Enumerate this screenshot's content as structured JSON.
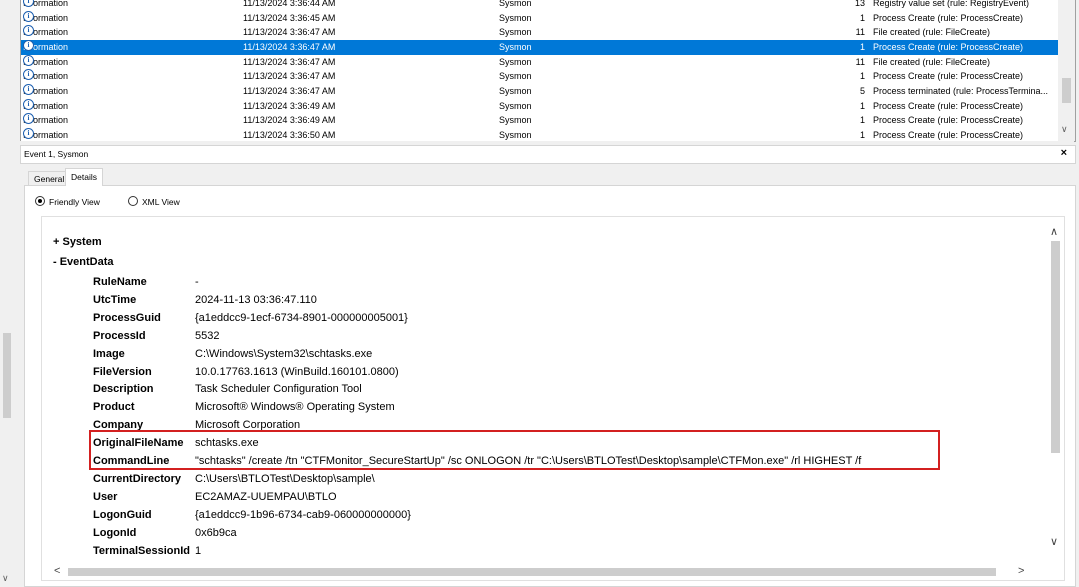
{
  "grid": {
    "rows": [
      {
        "level": "Information",
        "date": "11/13/2024 3:36:44 AM",
        "source": "Sysmon",
        "event_id": "13",
        "task": "Registry value set (rule: RegistryEvent)"
      },
      {
        "level": "Information",
        "date": "11/13/2024 3:36:45 AM",
        "source": "Sysmon",
        "event_id": "1",
        "task": "Process Create (rule: ProcessCreate)"
      },
      {
        "level": "Information",
        "date": "11/13/2024 3:36:47 AM",
        "source": "Sysmon",
        "event_id": "11",
        "task": "File created (rule: FileCreate)"
      },
      {
        "level": "Information",
        "date": "11/13/2024 3:36:47 AM",
        "source": "Sysmon",
        "event_id": "1",
        "task": "Process Create (rule: ProcessCreate)",
        "selected": true
      },
      {
        "level": "Information",
        "date": "11/13/2024 3:36:47 AM",
        "source": "Sysmon",
        "event_id": "11",
        "task": "File created (rule: FileCreate)"
      },
      {
        "level": "Information",
        "date": "11/13/2024 3:36:47 AM",
        "source": "Sysmon",
        "event_id": "1",
        "task": "Process Create (rule: ProcessCreate)"
      },
      {
        "level": "Information",
        "date": "11/13/2024 3:36:47 AM",
        "source": "Sysmon",
        "event_id": "5",
        "task": "Process terminated (rule: ProcessTermina..."
      },
      {
        "level": "Information",
        "date": "11/13/2024 3:36:49 AM",
        "source": "Sysmon",
        "event_id": "1",
        "task": "Process Create (rule: ProcessCreate)"
      },
      {
        "level": "Information",
        "date": "11/13/2024 3:36:49 AM",
        "source": "Sysmon",
        "event_id": "1",
        "task": "Process Create (rule: ProcessCreate)"
      },
      {
        "level": "Information",
        "date": "11/13/2024 3:36:50 AM",
        "source": "Sysmon",
        "event_id": "1",
        "task": "Process Create (rule: ProcessCreate)"
      }
    ]
  },
  "event_header": {
    "title": "Event 1, Sysmon",
    "close": "×"
  },
  "tabs": {
    "general": "General",
    "details": "Details"
  },
  "view_mode": {
    "friendly": "Friendly View",
    "xml": "XML View"
  },
  "tree": {
    "system": "+ System",
    "eventdata": "- EventData"
  },
  "event_data": [
    {
      "key": "RuleName",
      "value": "-"
    },
    {
      "key": "UtcTime",
      "value": "2024-11-13 03:36:47.110"
    },
    {
      "key": "ProcessGuid",
      "value": "{a1eddcc9-1ecf-6734-8901-000000005001}"
    },
    {
      "key": "ProcessId",
      "value": "5532"
    },
    {
      "key": "Image",
      "value": "C:\\Windows\\System32\\schtasks.exe"
    },
    {
      "key": "FileVersion",
      "value": "10.0.17763.1613 (WinBuild.160101.0800)"
    },
    {
      "key": "Description",
      "value": "Task Scheduler Configuration Tool"
    },
    {
      "key": "Product",
      "value": "Microsoft® Windows® Operating System"
    },
    {
      "key": "Company",
      "value": "Microsoft Corporation"
    },
    {
      "key": "OriginalFileName",
      "value": "schtasks.exe"
    },
    {
      "key": "CommandLine",
      "value": "\"schtasks\" /create /tn \"CTFMonitor_SecureStartUp\" /sc ONLOGON /tr \"C:\\Users\\BTLOTest\\Desktop\\sample\\CTFMon.exe\" /rl HIGHEST /f"
    },
    {
      "key": "CurrentDirectory",
      "value": "C:\\Users\\BTLOTest\\Desktop\\sample\\"
    },
    {
      "key": "User",
      "value": "EC2AMAZ-UUEMPAU\\BTLO"
    },
    {
      "key": "LogonGuid",
      "value": "{a1eddcc9-1b96-6734-cab9-060000000000}"
    },
    {
      "key": "LogonId",
      "value": "0x6b9ca"
    },
    {
      "key": "TerminalSessionId",
      "value": "1"
    }
  ],
  "colors": {
    "selection": "#0078d7",
    "highlight_border": "#d32020"
  }
}
